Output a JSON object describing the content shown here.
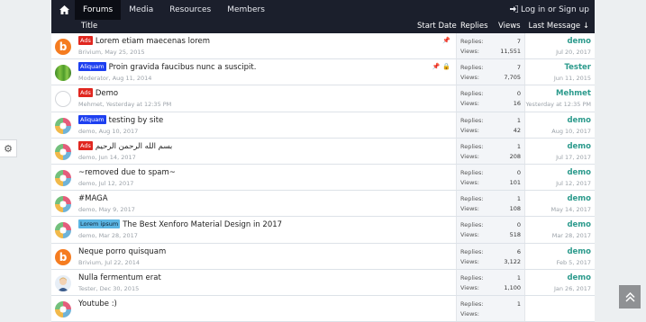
{
  "nav": {
    "home_icon": "home-icon",
    "items": [
      {
        "label": "Forums",
        "active": true
      },
      {
        "label": "Media",
        "active": false
      },
      {
        "label": "Resources",
        "active": false
      },
      {
        "label": "Members",
        "active": false
      }
    ],
    "login_label": "Log in or Sign up"
  },
  "header": {
    "title": "Title",
    "start_date": "Start Date",
    "replies": "Replies",
    "views": "Views",
    "last_message": "Last Message ↓"
  },
  "labels": {
    "replies": "Replies:",
    "views": "Views:"
  },
  "threads": [
    {
      "avatar": "b",
      "prefix": "Ads",
      "prefix_type": "ads",
      "title": "Lorem etiam maecenas lorem",
      "author": "Brivium",
      "date": "May 25, 2015",
      "icons": [
        "pin-icon"
      ],
      "replies": "7",
      "views": "11,551",
      "last_user": "demo",
      "last_date": "Jul 20, 2017"
    },
    {
      "avatar": "leaf",
      "prefix": "Aliquam",
      "prefix_type": "aliquam",
      "title": "Proin gravida faucibus nunc a suscipit.",
      "author": "Moderator",
      "date": "Aug 11, 2014",
      "icons": [
        "pin-icon",
        "lock-icon"
      ],
      "replies": "7",
      "views": "7,705",
      "last_user": "Tester",
      "last_date": "Jun 11, 2015"
    },
    {
      "avatar": "grey",
      "prefix": "Ads",
      "prefix_type": "ads",
      "title": "Demo",
      "author": "Mehmet",
      "date": "Yesterday at 12:35 PM",
      "icons": [],
      "replies": "0",
      "views": "16",
      "last_user": "Mehmet",
      "last_date": "Yesterday at 12:35 PM"
    },
    {
      "avatar": "demo",
      "prefix": "Aliquam",
      "prefix_type": "aliquam",
      "title": "testing by site",
      "author": "demo",
      "date": "Aug 10, 2017",
      "icons": [],
      "replies": "1",
      "views": "42",
      "last_user": "demo",
      "last_date": "Aug 10, 2017"
    },
    {
      "avatar": "demo",
      "prefix": "Ads",
      "prefix_type": "ads",
      "title": "بسم الله الرحمن الرحيم",
      "author": "demo",
      "date": "Jun 14, 2017",
      "icons": [],
      "replies": "1",
      "views": "208",
      "last_user": "demo",
      "last_date": "Jul 17, 2017"
    },
    {
      "avatar": "demo",
      "prefix": "",
      "prefix_type": "",
      "title": "~removed due to spam~",
      "author": "demo",
      "date": "Jul 12, 2017",
      "icons": [],
      "replies": "0",
      "views": "101",
      "last_user": "demo",
      "last_date": "Jul 12, 2017"
    },
    {
      "avatar": "demo",
      "prefix": "",
      "prefix_type": "",
      "title": "#MAGA",
      "author": "demo",
      "date": "May 9, 2017",
      "icons": [],
      "replies": "1",
      "views": "108",
      "last_user": "demo",
      "last_date": "May 14, 2017"
    },
    {
      "avatar": "demo",
      "prefix": "Lorem ipsum",
      "prefix_type": "lorem",
      "title": "The Best Xenforo Material Design in 2017",
      "author": "demo",
      "date": "Mar 28, 2017",
      "icons": [],
      "replies": "0",
      "views": "518",
      "last_user": "demo",
      "last_date": "Mar 28, 2017"
    },
    {
      "avatar": "b",
      "prefix": "",
      "prefix_type": "",
      "title": "Neque porro quisquam",
      "author": "Brivium",
      "date": "Jul 22, 2014",
      "icons": [],
      "replies": "6",
      "views": "3,122",
      "last_user": "demo",
      "last_date": "Feb 5, 2017"
    },
    {
      "avatar": "tester",
      "prefix": "",
      "prefix_type": "",
      "title": "Nulla fermentum erat",
      "author": "Tester",
      "date": "Dec 30, 2015",
      "icons": [],
      "replies": "1",
      "views": "1,100",
      "last_user": "demo",
      "last_date": "Jan 26, 2017"
    },
    {
      "avatar": "demo",
      "prefix": "",
      "prefix_type": "",
      "title": "Youtube :)",
      "author": "",
      "date": "",
      "icons": [],
      "replies": "1",
      "views": "",
      "last_user": "",
      "last_date": ""
    }
  ],
  "colors": {
    "accent": "#2d9b8d",
    "nav_bg": "#1b1f2c",
    "ads": "#e0261f",
    "aliquam": "#1d3ff0",
    "lorem": "#5bb5e3"
  }
}
